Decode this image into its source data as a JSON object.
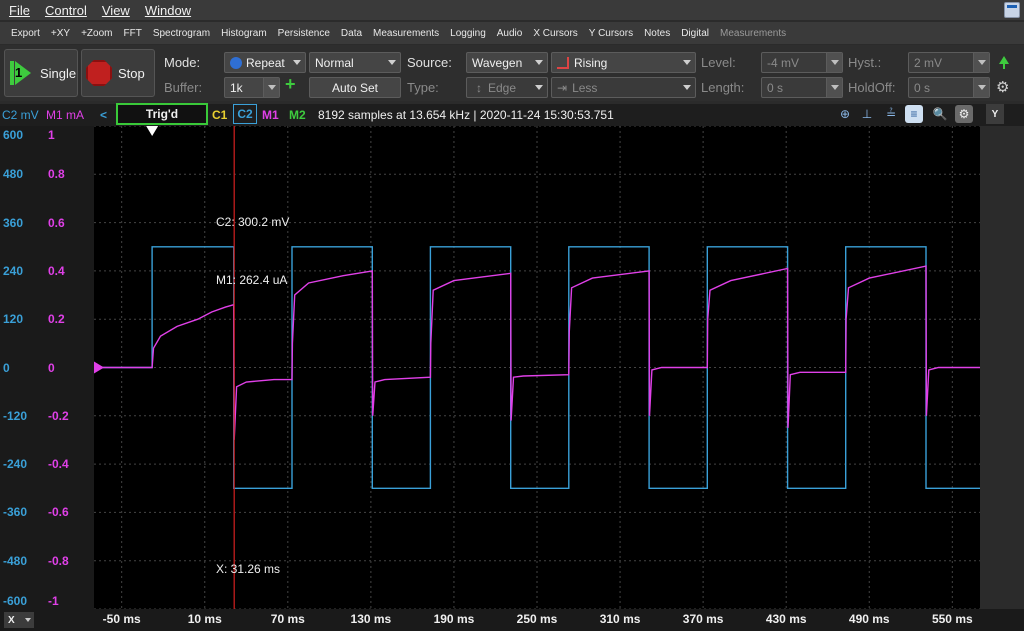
{
  "menubar": {
    "items": [
      "File",
      "Control",
      "View",
      "Window"
    ]
  },
  "toolbar": {
    "items": [
      "Export",
      "+XY",
      "+Zoom",
      "FFT",
      "Spectrogram",
      "Histogram",
      "Persistence",
      "Data",
      "Measurements",
      "Logging",
      "Audio",
      "X Cursors",
      "Y Cursors",
      "Notes",
      "Digital"
    ],
    "dim_item": "Measurements"
  },
  "controls": {
    "single_label": "Single",
    "single_number": "1",
    "stop_label": "Stop",
    "mode_label": "Mode:",
    "mode_value": "Repeat",
    "trigger_mode": "Normal",
    "buffer_label": "Buffer:",
    "buffer_value": "1k",
    "autoset_label": "Auto Set",
    "source_label": "Source:",
    "source_value": "Wavegen",
    "type_label": "Type:",
    "type_value": "Edge",
    "condition_value": "Rising",
    "condition2_value": "Less",
    "level_label": "Level:",
    "level_value": "-4 mV",
    "length_label": "Length:",
    "length_value": "0 s",
    "hyst_label": "Hyst.:",
    "hyst_value": "2 mV",
    "holdoff_label": "HoldOff:",
    "holdoff_value": "0 s"
  },
  "status": {
    "c2_unit": "C2 mV",
    "m1_unit": "M1 mA",
    "trig_state": "Trig'd",
    "ch_c1": "C1",
    "ch_c2": "C2",
    "ch_m1": "M1",
    "ch_m2": "M2",
    "info": "8192 samples at 13.654 kHz | 2020-11-24 15:30:53.751",
    "y_button": "Y"
  },
  "colors": {
    "c2": "#3aa0d8",
    "m1": "#e040e8",
    "m2": "#3ecb3e",
    "c1": "#e8d030",
    "cursor": "#d42020"
  },
  "chart_data": {
    "type": "line",
    "x_unit": "ms",
    "xlim": [
      -70,
      570
    ],
    "x_ticks": [
      "-50 ms",
      "10 ms",
      "70 ms",
      "130 ms",
      "190 ms",
      "250 ms",
      "310 ms",
      "370 ms",
      "430 ms",
      "490 ms",
      "550 ms"
    ],
    "x_tick_values": [
      -50,
      10,
      70,
      130,
      190,
      250,
      310,
      370,
      430,
      490,
      550
    ],
    "y_left_ticks": [
      "600",
      "480",
      "360",
      "240",
      "120",
      "0",
      "-120",
      "-240",
      "-360",
      "-480",
      "-600"
    ],
    "y_right_ticks": [
      "1",
      "0.8",
      "0.6",
      "0.4",
      "0.2",
      "0",
      "-0.2",
      "-0.4",
      "-0.6",
      "-0.8",
      "-1"
    ],
    "ylim_c2": [
      -600,
      600
    ],
    "ylim_m1": [
      -1,
      1
    ],
    "series": [
      {
        "name": "C2",
        "unit": "mV",
        "x": [
          -70,
          -28,
          -28,
          31,
          31,
          73,
          73,
          131,
          131,
          173,
          173,
          231,
          231,
          273,
          273,
          331,
          331,
          373,
          373,
          431,
          431,
          473,
          473,
          531,
          531,
          570
        ],
        "values": [
          0,
          0,
          300,
          300,
          -300,
          -300,
          300,
          300,
          -300,
          -300,
          300,
          300,
          -300,
          -300,
          300,
          300,
          -300,
          -300,
          300,
          300,
          -300,
          -300,
          300,
          300,
          -300,
          -300
        ]
      },
      {
        "name": "M1",
        "unit": "mA",
        "x": [
          -70,
          -28,
          -27,
          -22,
          -10,
          5,
          15,
          25,
          31,
          31.3,
          33,
          40,
          60,
          73,
          73.3,
          75,
          85,
          110,
          131,
          131.3,
          133,
          140,
          173,
          173.3,
          175,
          190,
          231,
          231.3,
          233,
          240,
          273,
          273.3,
          275,
          290,
          331,
          331.3,
          333,
          340,
          373,
          373.3,
          375,
          390,
          431,
          431.3,
          433,
          440,
          473,
          473.3,
          475,
          490,
          531,
          531.3,
          533,
          540,
          570
        ],
        "values": [
          0,
          0,
          0.08,
          0.13,
          0.17,
          0.2,
          0.23,
          0.25,
          0.26,
          -0.3,
          -0.08,
          -0.06,
          -0.05,
          -0.05,
          0.1,
          0.3,
          0.35,
          0.38,
          0.4,
          -0.2,
          -0.06,
          -0.05,
          -0.04,
          0.1,
          0.32,
          0.36,
          0.39,
          -0.22,
          -0.04,
          -0.035,
          -0.03,
          0.15,
          0.33,
          0.37,
          0.4,
          -0.2,
          -0.01,
          0,
          0,
          0.2,
          0.32,
          0.36,
          0.41,
          -0.25,
          -0.03,
          -0.02,
          -0.02,
          0.2,
          0.33,
          0.37,
          0.42,
          -0.2,
          -0.01,
          0,
          0
        ]
      }
    ],
    "cursor": {
      "x_label": "X: 31.26 ms",
      "x_value": 31.26
    },
    "annotations": {
      "c2_value": "C2: 300.2 mV",
      "m1_value": "M1: 262.4 uA"
    },
    "grid": true
  }
}
